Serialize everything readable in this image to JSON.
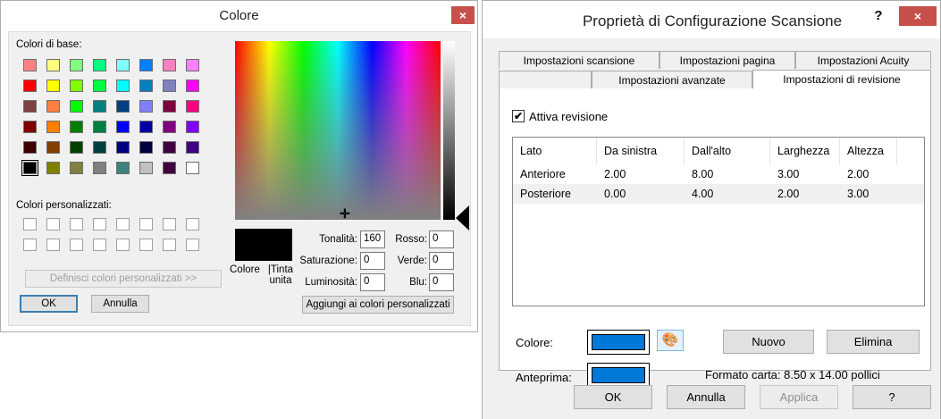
{
  "color_dialog": {
    "title": "Colore",
    "close": "×",
    "basic_colors_label": "Colori di base:",
    "basic_colors": [
      [
        "#ff8080",
        "#ffff80",
        "#80ff80",
        "#00ff80",
        "#80ffff",
        "#0080ff",
        "#ff80c0",
        "#ff80ff"
      ],
      [
        "#ff0000",
        "#ffff00",
        "#80ff00",
        "#00ff40",
        "#00ffff",
        "#0080c0",
        "#8080c0",
        "#ff00ff"
      ],
      [
        "#804040",
        "#ff8040",
        "#00ff00",
        "#008080",
        "#004080",
        "#8080ff",
        "#800040",
        "#ff0080"
      ],
      [
        "#800000",
        "#ff8000",
        "#008000",
        "#008040",
        "#0000ff",
        "#0000a0",
        "#800080",
        "#8000ff"
      ],
      [
        "#400000",
        "#804000",
        "#004000",
        "#004040",
        "#000080",
        "#000040",
        "#400040",
        "#400080"
      ],
      [
        "#000000",
        "#808000",
        "#808040",
        "#808080",
        "#408080",
        "#c0c0c0",
        "#400040",
        "#ffffff"
      ]
    ],
    "custom_colors_label": "Colori personalizzati:",
    "define_button": "Definisci colori personalizzati >>",
    "ok_button": "OK",
    "cancel_button": "Annulla",
    "color_label": "Colore",
    "solid_label": "|Tinta unita",
    "hue_label": "Tonalità:",
    "hue": "160",
    "sat_label": "Saturazione:",
    "sat": "0",
    "lum_label": "Luminosità:",
    "lum": "0",
    "red_label": "Rosso:",
    "red": "0",
    "green_label": "Verde:",
    "green": "0",
    "blue_label": "Blu:",
    "blue": "0",
    "add_custom_button": "Aggiungi ai colori personalizzati",
    "selected_color": "#000000"
  },
  "scan_dialog": {
    "title": "Proprietà di Configurazione Scansione",
    "help": "?",
    "close": "×",
    "tabs_row1": [
      "Impostazioni scansione",
      "Impostazioni pagina",
      "Impostazioni Acuity"
    ],
    "tabs_row2": [
      "",
      "Impostazioni avanzate",
      "Impostazioni di revisione"
    ],
    "checkbox_label": "Attiva revisione",
    "checked": true,
    "columns": [
      "Lato",
      "Da sinistra",
      "Dall'alto",
      "Larghezza",
      "Altezza"
    ],
    "rows": [
      [
        "Anteriore",
        "2.00",
        "8.00",
        "3.00",
        "2.00"
      ],
      [
        "Posteriore",
        "0.00",
        "4.00",
        "2.00",
        "3.00"
      ]
    ],
    "color_label": "Colore:",
    "preview_label": "Anteprima:",
    "swatch_color": "#0078d7",
    "new_button": "Nuovo",
    "delete_button": "Elimina",
    "paper_format": "Formato carta: 8.50 x 14.00 pollici",
    "ok_button": "OK",
    "cancel_button": "Annulla",
    "apply_button": "Applica",
    "help_button": "?"
  }
}
